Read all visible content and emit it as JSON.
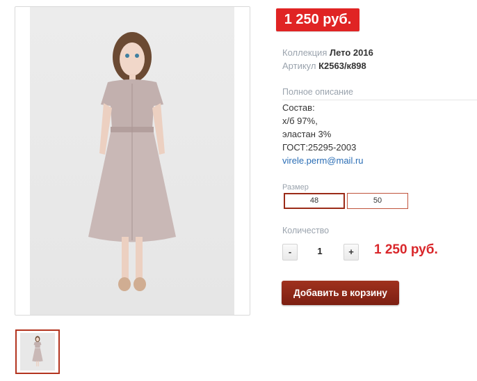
{
  "price_badge": "1 250 руб.",
  "meta": {
    "collection_key": "Коллекция",
    "collection_value": "Лето 2016",
    "sku_key": "Артикул",
    "sku_value": "К2563/к898"
  },
  "description": {
    "title": "Полное описание",
    "lines": [
      "Состав:",
      "х/б 97%,",
      "эластан 3%",
      "ГОСТ:25295-2003"
    ],
    "email": "virele.perm@mail.ru"
  },
  "size": {
    "label": "Размер",
    "options": [
      "48",
      "50"
    ],
    "selected": "48"
  },
  "quantity": {
    "label": "Количество",
    "minus": "-",
    "plus": "+",
    "value": "1",
    "total": "1 250 руб."
  },
  "add_to_cart_label": "Добавить в корзину",
  "colors": {
    "badge": "#e02424",
    "accent": "#9b2b18",
    "price_total": "#d9262a",
    "link": "#2a6db5",
    "dress": "#c2b0ae"
  },
  "images": {
    "main": "model-dress-photo",
    "thumbnail": "model-dress-thumbnail"
  }
}
